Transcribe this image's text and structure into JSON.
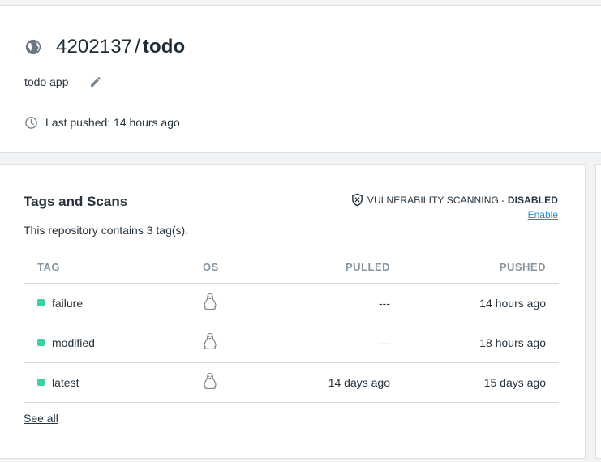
{
  "repo": {
    "namespace": "4202137",
    "slash": "/",
    "name": "todo",
    "description": "todo app",
    "last_pushed": "Last pushed: 14 hours ago"
  },
  "tags_section": {
    "title": "Tags and Scans",
    "count_text": "This repository contains 3 tag(s).",
    "vuln_label": "VULNERABILITY SCANNING - ",
    "vuln_status": "DISABLED",
    "enable_link": "Enable",
    "columns": {
      "tag": "TAG",
      "os": "OS",
      "pulled": "PULLED",
      "pushed": "PUSHED"
    },
    "rows": [
      {
        "tag": "failure",
        "os_icon": "linux-icon",
        "pulled": "---",
        "pushed": "14 hours ago"
      },
      {
        "tag": "modified",
        "os_icon": "linux-icon",
        "pulled": "---",
        "pushed": "18 hours ago"
      },
      {
        "tag": "latest",
        "os_icon": "linux-icon",
        "pulled": "14 days ago",
        "pushed": "15 days ago"
      }
    ],
    "see_all": "See all"
  },
  "icons": {
    "globe": "globe-icon",
    "edit": "pencil-icon",
    "clock": "clock-icon",
    "shield": "shield-x-icon",
    "os": "linux-tux-icon"
  },
  "colors": {
    "status_dot": "#3fcfa4",
    "link": "#1a8fd6",
    "header_text": "#8795a1"
  }
}
